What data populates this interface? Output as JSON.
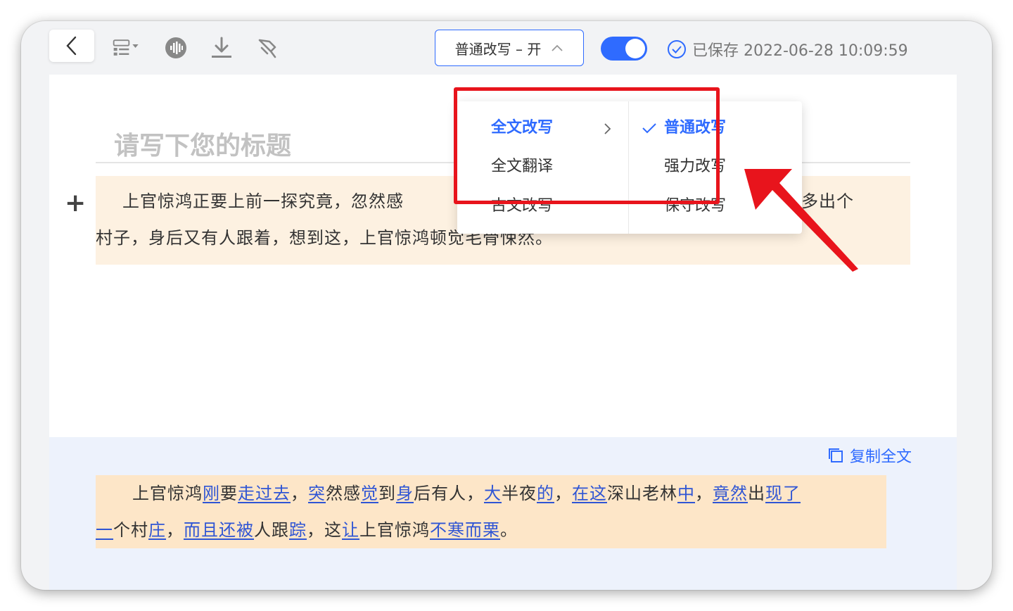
{
  "toolbar": {
    "mode_button_label": "普通改写 – 开",
    "toggle_on": true,
    "saved_text": "已保存 2022-06-28 10:09:59"
  },
  "editor": {
    "title_placeholder": "请写下您的标题",
    "paragraph_line1": "上官惊鸿正要上前一探究竟，忽然感",
    "paragraph_line1_tail": "名其妙多出个",
    "paragraph_line2": "村子，身后又有人跟着，想到这，上官惊鸿顿觉毛骨悚然。"
  },
  "dropdown": {
    "left_items": [
      {
        "label": "全文改写",
        "active": true
      },
      {
        "label": "全文翻译",
        "active": false
      },
      {
        "label": "古文改写",
        "active": false
      }
    ],
    "right_items": [
      {
        "label": "普通改写",
        "checked": true
      },
      {
        "label": "强力改写",
        "checked": false
      },
      {
        "label": "保守改写",
        "checked": false
      }
    ]
  },
  "output": {
    "copy_all_label": "复制全文",
    "segments_line1": [
      {
        "t": "上官惊鸿",
        "c": false
      },
      {
        "t": "刚",
        "c": true
      },
      {
        "t": "要",
        "c": false
      },
      {
        "t": "走过去",
        "c": true
      },
      {
        "t": "，",
        "c": false
      },
      {
        "t": "突",
        "c": true
      },
      {
        "t": "然感",
        "c": false
      },
      {
        "t": "觉",
        "c": true
      },
      {
        "t": "到",
        "c": false
      },
      {
        "t": "身",
        "c": true
      },
      {
        "t": "后有人，",
        "c": false
      },
      {
        "t": "大",
        "c": true
      },
      {
        "t": "半夜",
        "c": false
      },
      {
        "t": "的",
        "c": true
      },
      {
        "t": "，",
        "c": false
      },
      {
        "t": "在这",
        "c": true
      },
      {
        "t": "深山老林",
        "c": false
      },
      {
        "t": "中",
        "c": true
      },
      {
        "t": "，",
        "c": false
      },
      {
        "t": "竟然",
        "c": true
      },
      {
        "t": "出",
        "c": false
      },
      {
        "t": "现了",
        "c": true
      }
    ],
    "segments_line2": [
      {
        "t": "一",
        "c": true
      },
      {
        "t": "个村",
        "c": false
      },
      {
        "t": "庄",
        "c": true
      },
      {
        "t": "，",
        "c": false
      },
      {
        "t": "而且还被",
        "c": true
      },
      {
        "t": "人跟",
        "c": false
      },
      {
        "t": "踪",
        "c": true
      },
      {
        "t": "，这",
        "c": false
      },
      {
        "t": "让",
        "c": true
      },
      {
        "t": "上官惊鸿",
        "c": false
      },
      {
        "t": "不寒而栗",
        "c": true
      },
      {
        "t": "。",
        "c": false
      }
    ]
  },
  "colors": {
    "accent": "#2f6bff",
    "highlight_box": "#e8141c",
    "source_para_bg": "#fdf1e1",
    "output_para_bg": "#fde6c8"
  },
  "icons": [
    "chevron-left-icon",
    "layout-list-icon",
    "audio-wave-icon",
    "download-icon",
    "pin-icon",
    "check-circle-icon",
    "copy-icon",
    "check-icon",
    "chevron-right-icon",
    "chevron-up-icon"
  ]
}
